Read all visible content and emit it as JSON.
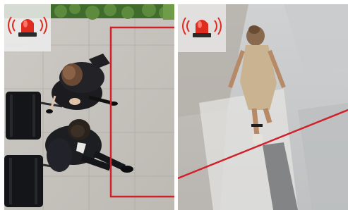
{
  "colors": {
    "detection_line": "#d0202a",
    "alarm_red": "#e02b1f",
    "badge_bg": "#ececec"
  },
  "panels": [
    {
      "scene": "people-with-luggage-top-view",
      "icon": "siren-alarm-icon",
      "zone_shape": "rectangle"
    },
    {
      "scene": "woman-walking-top-view",
      "icon": "siren-alarm-icon",
      "zone_shape": "diagonal-line"
    }
  ]
}
